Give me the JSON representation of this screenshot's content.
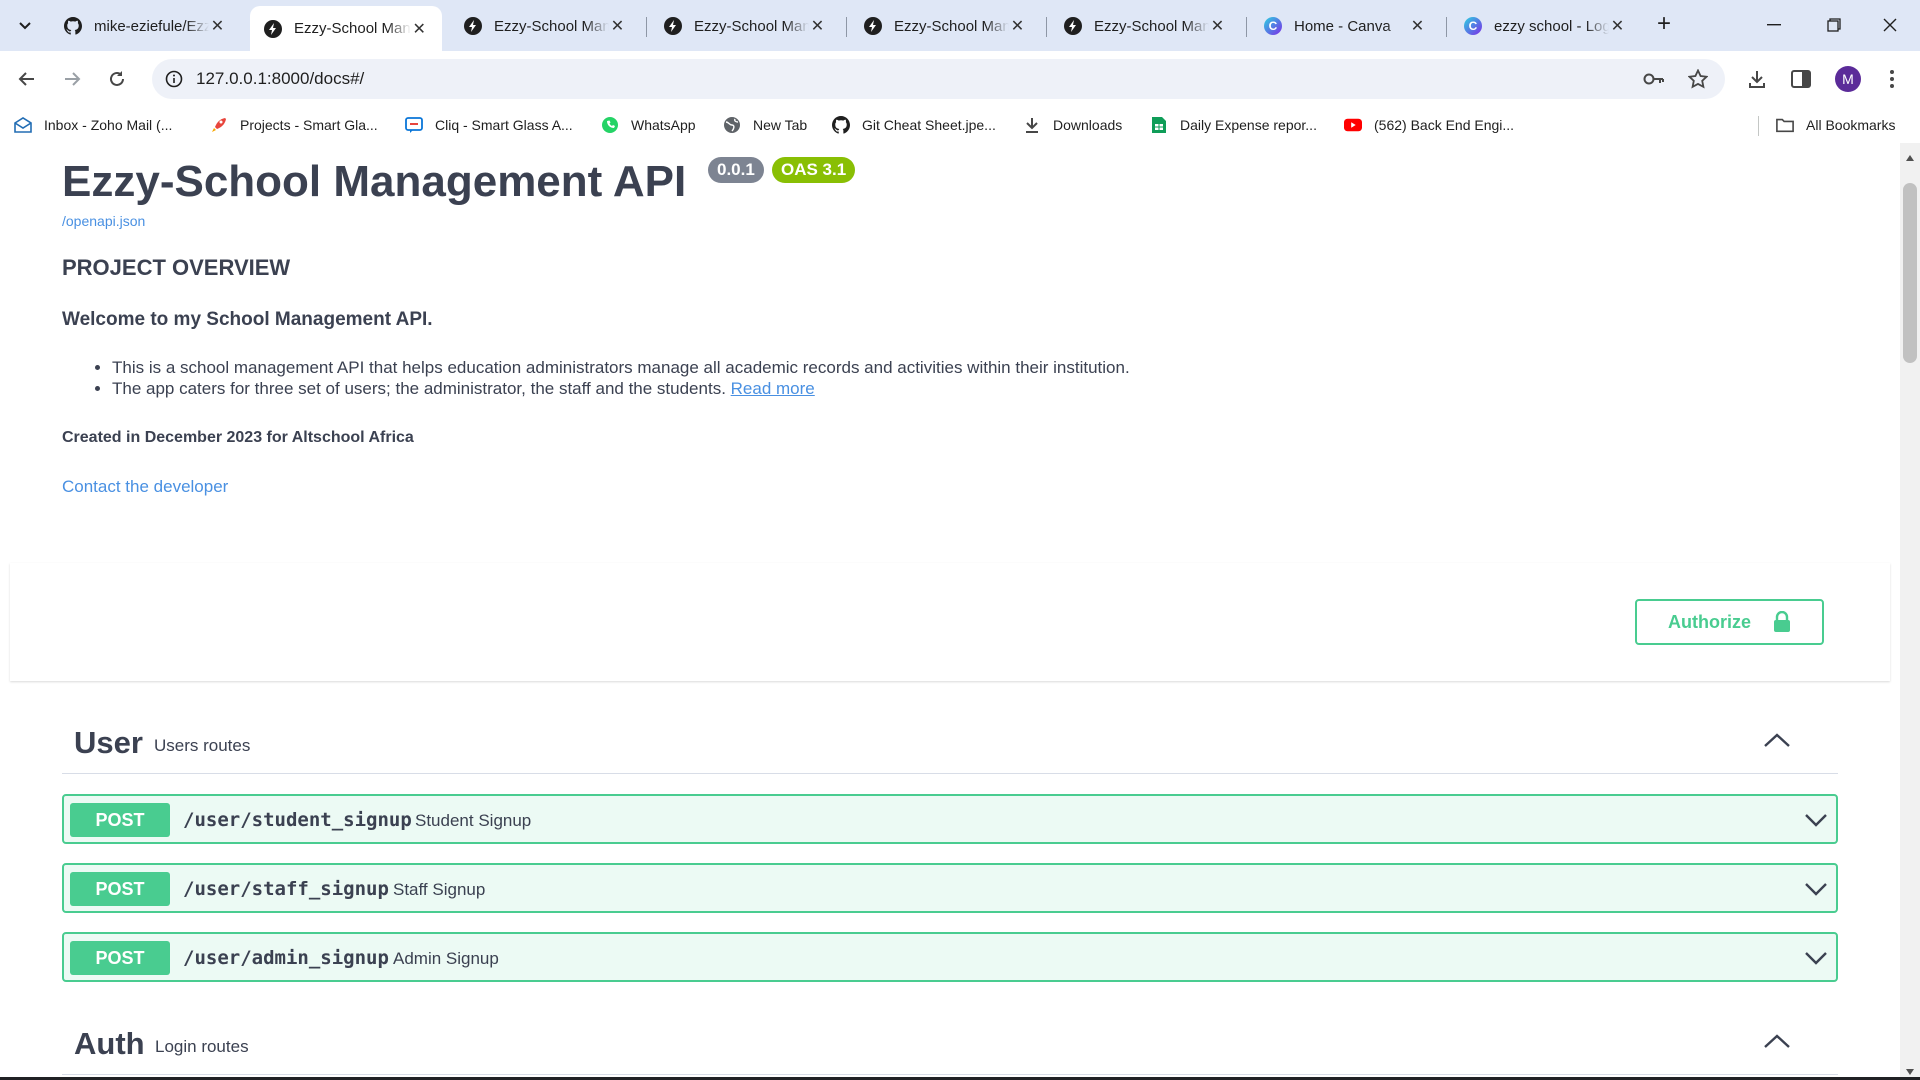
{
  "browser": {
    "tabs": [
      {
        "title": "mike-eziefule/Ezzy-School",
        "icon": "github-icon",
        "active": false
      },
      {
        "title": "Ezzy-School Management",
        "icon": "fastapi-icon",
        "active": true
      },
      {
        "title": "Ezzy-School Management",
        "icon": "fastapi-icon",
        "active": false
      },
      {
        "title": "Ezzy-School Management",
        "icon": "fastapi-icon",
        "active": false
      },
      {
        "title": "Ezzy-School Management",
        "icon": "fastapi-icon",
        "active": false
      },
      {
        "title": "Ezzy-School Management",
        "icon": "fastapi-icon",
        "active": false
      },
      {
        "title": "Home - Canva",
        "icon": "canva-icon",
        "active": false
      },
      {
        "title": "ezzy school - Logo",
        "icon": "canva-icon",
        "active": false
      }
    ],
    "url": "127.0.0.1:8000/docs#/",
    "avatar_initial": "M",
    "bookmarks": [
      {
        "label": "Inbox - Zoho Mail (...",
        "icon": "mail-icon"
      },
      {
        "label": "Projects - Smart Gla...",
        "icon": "rocket-icon"
      },
      {
        "label": "Cliq - Smart Glass A...",
        "icon": "chat-icon"
      },
      {
        "label": "WhatsApp",
        "icon": "whatsapp-icon"
      },
      {
        "label": "New Tab",
        "icon": "globe-icon"
      },
      {
        "label": "Git Cheat Sheet.jpe...",
        "icon": "github-icon"
      },
      {
        "label": "Downloads",
        "icon": "download-icon"
      },
      {
        "label": "Daily Expense repor...",
        "icon": "sheets-icon"
      },
      {
        "label": "(562) Back End Engi...",
        "icon": "youtube-icon"
      }
    ],
    "all_bookmarks": "All Bookmarks"
  },
  "doc": {
    "title": "Ezzy-School Management API",
    "version": "0.0.1",
    "oas": "OAS 3.1",
    "openapi_link": "/openapi.json",
    "overview_heading": "PROJECT OVERVIEW",
    "welcome": "Welcome to my School Management API.",
    "bullet1": "This is a school management API that helps education administrators manage all academic records and activities within their institution.",
    "bullet2": "The app caters for three set of users; the administrator, the staff and the students.",
    "read_more": "Read more",
    "created": "Created in December 2023 for Altschool Africa",
    "contact": "Contact the developer",
    "authorize": "Authorize"
  },
  "sections": [
    {
      "name": "User",
      "description": "Users routes",
      "ops": [
        {
          "method": "POST",
          "path": "/user/student_signup",
          "summary": "Student Signup"
        },
        {
          "method": "POST",
          "path": "/user/staff_signup",
          "summary": "Staff Signup"
        },
        {
          "method": "POST",
          "path": "/user/admin_signup",
          "summary": "Admin Signup"
        }
      ]
    },
    {
      "name": "Auth",
      "description": "Login routes",
      "ops": []
    }
  ],
  "colors": {
    "post": "#49cc90",
    "text": "#3b4151",
    "link": "#4990e2",
    "version_badge": "#7d8492",
    "oas_badge": "#89bf04"
  }
}
